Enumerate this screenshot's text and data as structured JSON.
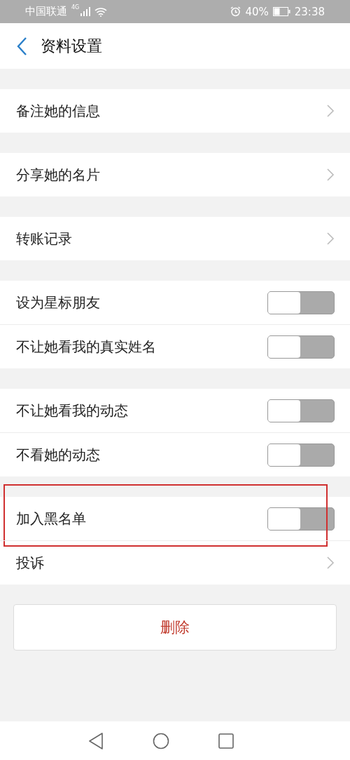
{
  "status_bar": {
    "carrier": "中国联通",
    "network": "4G",
    "battery_percent": "40%",
    "time": "23:38"
  },
  "header": {
    "title": "资料设置"
  },
  "sections": [
    {
      "rows": [
        {
          "kind": "link",
          "label": "备注她的信息",
          "highlighted": false
        }
      ]
    },
    {
      "rows": [
        {
          "kind": "link",
          "label": "分享她的名片",
          "highlighted": false
        }
      ]
    },
    {
      "rows": [
        {
          "kind": "link",
          "label": "转账记录",
          "highlighted": false
        }
      ]
    },
    {
      "rows": [
        {
          "kind": "toggle",
          "label": "设为星标朋友",
          "on": false,
          "highlighted": false
        },
        {
          "kind": "toggle",
          "label": "不让她看我的真实姓名",
          "on": false,
          "highlighted": false
        }
      ]
    },
    {
      "rows": [
        {
          "kind": "toggle",
          "label": "不让她看我的动态",
          "on": false,
          "highlighted": false
        },
        {
          "kind": "toggle",
          "label": "不看她的动态",
          "on": false,
          "highlighted": false
        }
      ]
    },
    {
      "rows": [
        {
          "kind": "toggle",
          "label": "加入黑名单",
          "on": false,
          "highlighted": true
        },
        {
          "kind": "link",
          "label": "投诉",
          "highlighted": false
        }
      ]
    }
  ],
  "delete_button": {
    "label": "删除"
  }
}
